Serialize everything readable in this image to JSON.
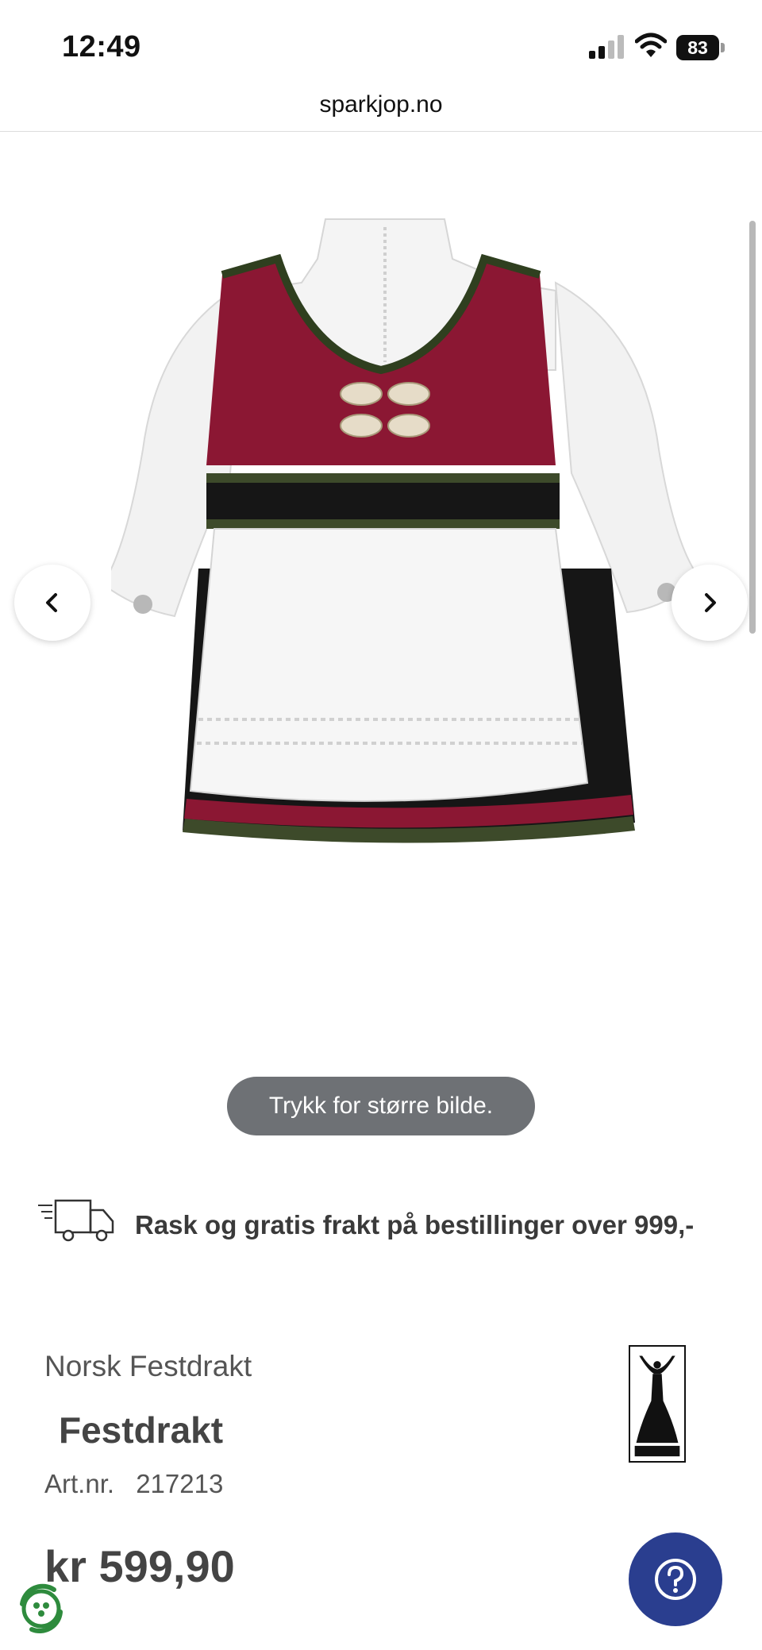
{
  "status_bar": {
    "time": "12:49",
    "battery": "83",
    "icons": [
      "cellular-signal-icon",
      "wifi-icon",
      "battery-icon"
    ]
  },
  "browser": {
    "url": "sparkjop.no"
  },
  "gallery": {
    "image_alt": "Festdrakt",
    "prev_icon": "chevron-left-icon",
    "next_icon": "chevron-right-icon",
    "tap_hint": "Trykk for større bilde."
  },
  "shipping": {
    "icon": "delivery-truck-icon",
    "text": "Rask og gratis frakt på bestillinger over 999,-"
  },
  "product": {
    "brand": "Norsk Festdrakt",
    "title": "Festdrakt",
    "artnr_label": "Art.nr.",
    "artnr_value": "217213",
    "price": "kr 599,90"
  },
  "floating": {
    "help_icon": "question-mark-icon",
    "badge_icon": "recycle-icon"
  },
  "colors": {
    "vest_red": "#8b1733",
    "skirt_black": "#161616",
    "help_button": "#2a3e8f",
    "tap_hint_bg": "#6e7175",
    "badge_green": "#2e8b3d"
  }
}
